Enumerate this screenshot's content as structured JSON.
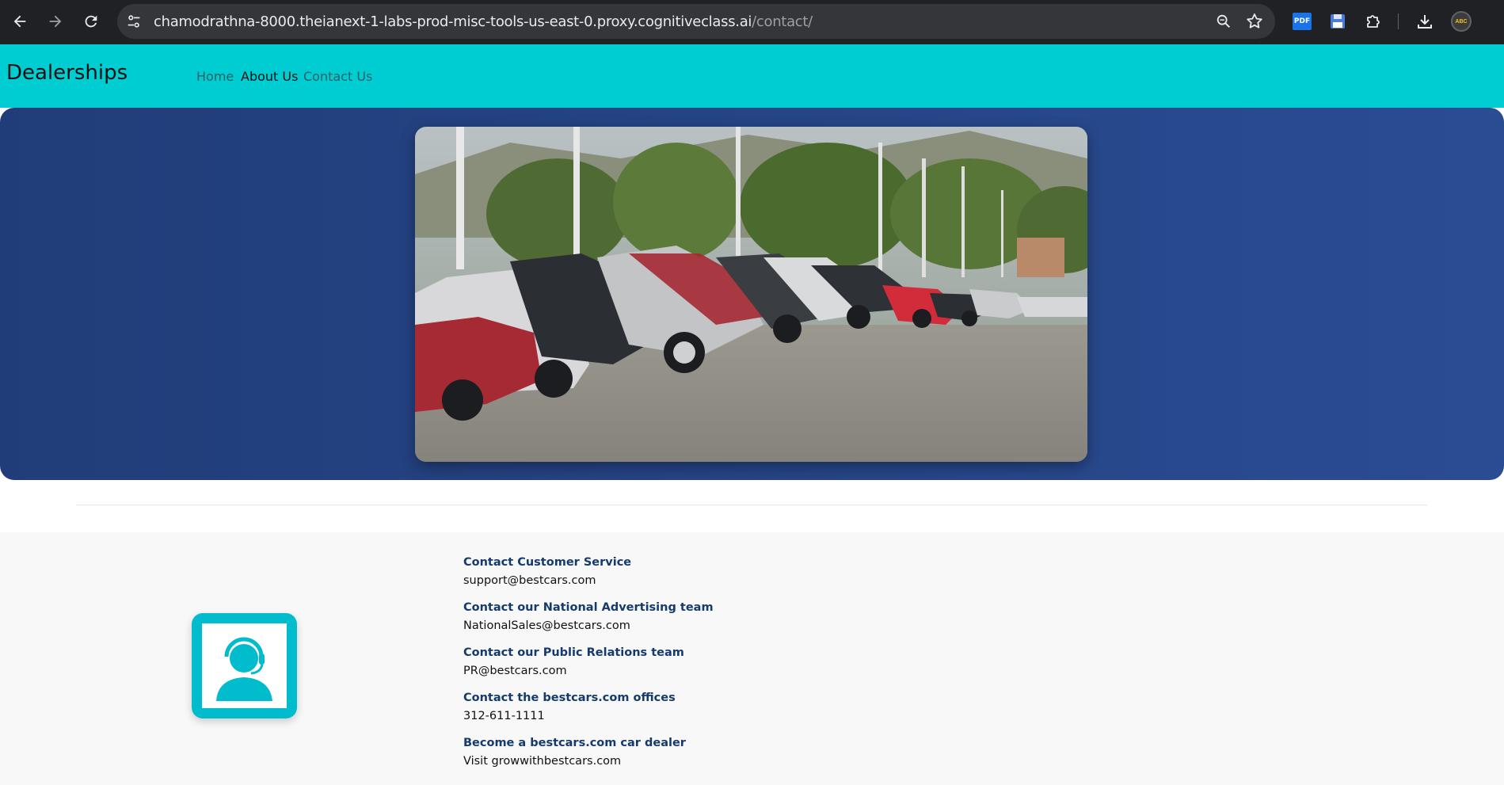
{
  "browser": {
    "url_host": "chamodrathna-8000.theianext-1-labs-prod-misc-tools-us-east-0.proxy.cognitiveclass.ai",
    "url_path": "/contact/",
    "pdf_label": "PDF",
    "profile_label": "ABC"
  },
  "header": {
    "brand": "Dealerships",
    "nav": {
      "home": "Home",
      "about": "About Us",
      "contact": "Contact Us"
    }
  },
  "contacts": [
    {
      "title": "Contact Customer Service",
      "value": "support@bestcars.com"
    },
    {
      "title": "Contact our National Advertising team",
      "value": "NationalSales@bestcars.com"
    },
    {
      "title": "Contact our Public Relations team",
      "value": "PR@bestcars.com"
    },
    {
      "title": "Contact the bestcars.com offices",
      "value": "312-611-1111"
    },
    {
      "title": "Become a bestcars.com car dealer",
      "value": "Visit growwithbestcars.com"
    }
  ],
  "colors": {
    "header_bg": "#00cdd2",
    "hero_bg": "#213d79",
    "contact_title": "#153a6e",
    "support_icon": "#00bccc"
  },
  "icons": {
    "back": "arrow-left-icon",
    "forward": "arrow-right-icon",
    "reload": "reload-icon",
    "site_info": "tune-icon",
    "zoom": "zoom-icon",
    "bookmark": "star-icon",
    "extension_pdf": "pdf-icon",
    "extension_save": "floppy-icon",
    "extensions": "puzzle-icon",
    "downloads": "download-icon",
    "support": "customer-support-icon"
  }
}
